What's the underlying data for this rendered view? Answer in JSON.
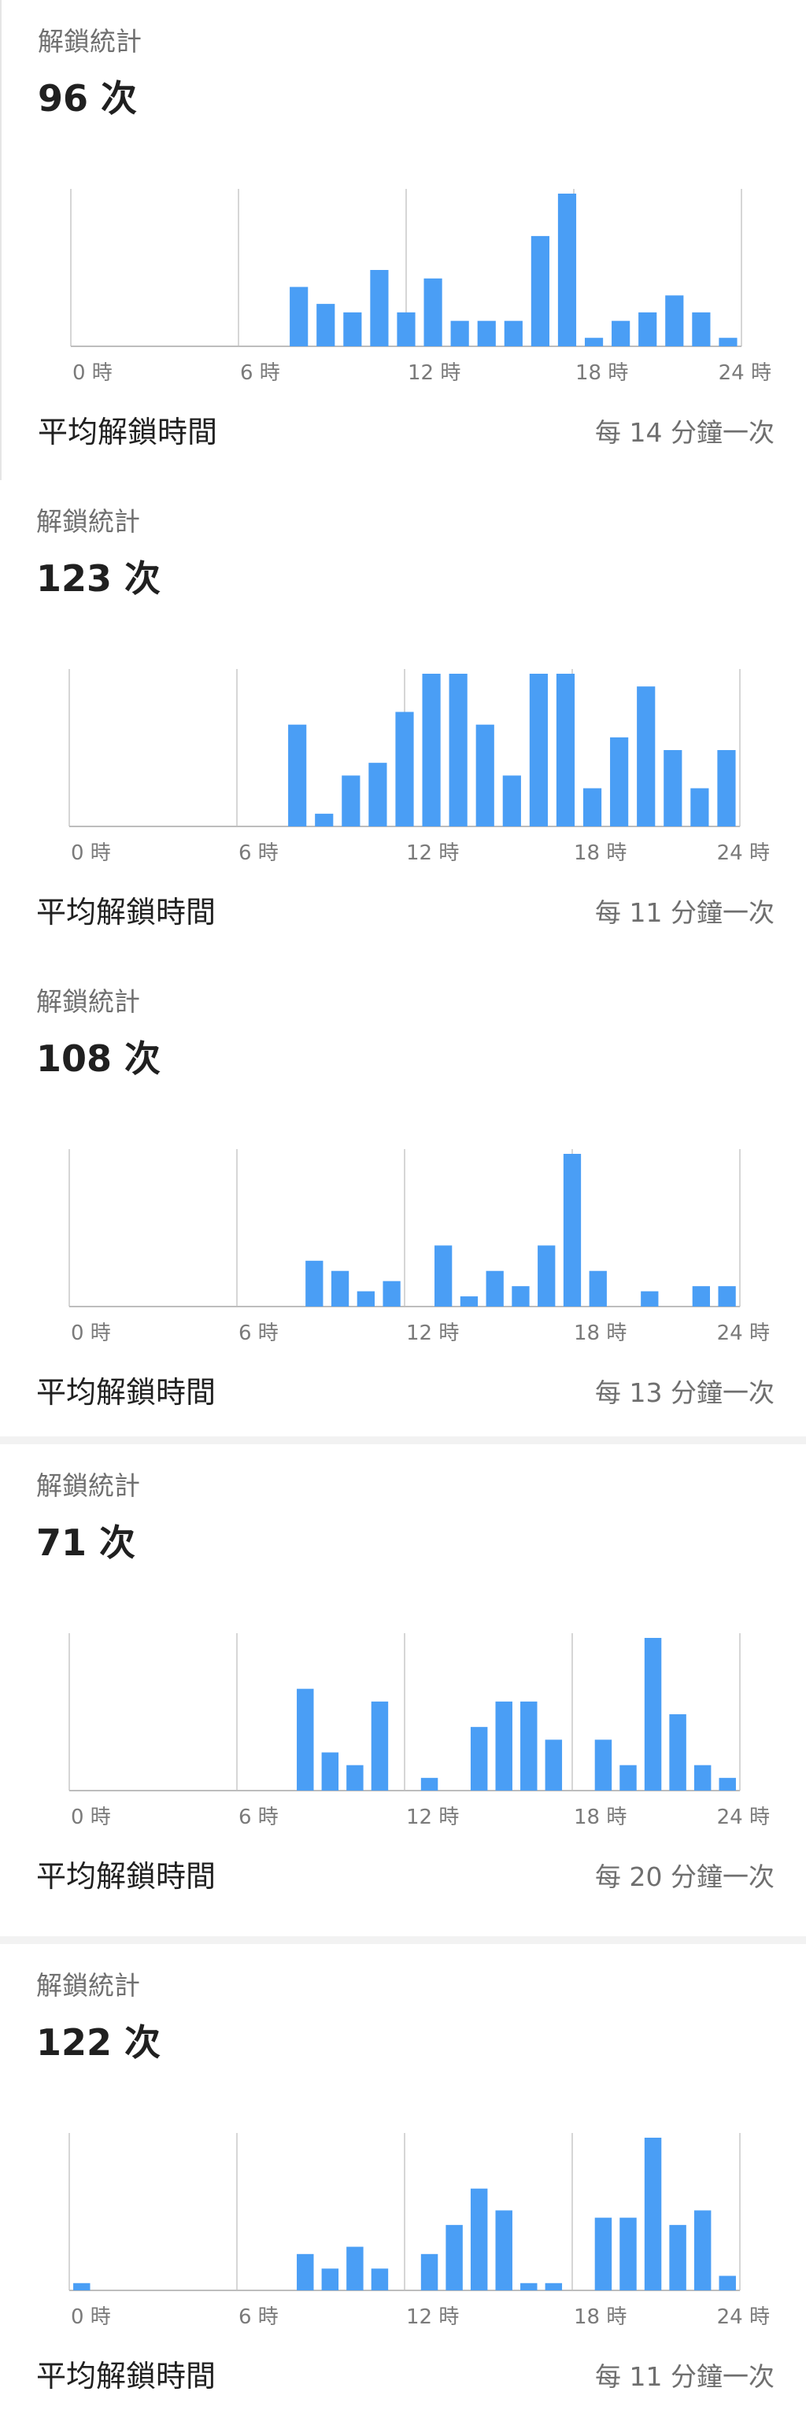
{
  "colors": {
    "bar": "#4a9ef5",
    "axis": "#bdbdbd",
    "grid": "#c8c8c8",
    "divider": "#f2f2f2"
  },
  "chart_data": [
    {
      "type": "bar",
      "title": "解鎖統計",
      "total_label": "96 次",
      "avg_label": "平均解鎖時間",
      "avg_value": "每 14 分鐘一次",
      "xticks": [
        "0 時",
        "6 時",
        "12 時",
        "18 時",
        "24 時"
      ],
      "x": [
        0,
        1,
        2,
        3,
        4,
        5,
        6,
        7,
        8,
        9,
        10,
        11,
        12,
        13,
        14,
        15,
        16,
        17,
        18,
        19,
        20,
        21,
        22,
        23
      ],
      "values": [
        0,
        0,
        0,
        0,
        0,
        0,
        0,
        0,
        7,
        5,
        4,
        9,
        4,
        8,
        3,
        3,
        3,
        13,
        18,
        1,
        3,
        4,
        6,
        4,
        1
      ],
      "ylim": [
        0,
        18
      ]
    },
    {
      "type": "bar",
      "title": "解鎖統計",
      "total_label": "123 次",
      "avg_label": "平均解鎖時間",
      "avg_value": "每 11 分鐘一次",
      "xticks": [
        "0 時",
        "6 時",
        "12 時",
        "18 時",
        "24 時"
      ],
      "x": [
        0,
        1,
        2,
        3,
        4,
        5,
        6,
        7,
        8,
        9,
        10,
        11,
        12,
        13,
        14,
        15,
        16,
        17,
        18,
        19,
        20,
        21,
        22,
        23
      ],
      "values": [
        0,
        0,
        0,
        0,
        0,
        0,
        0,
        0,
        8,
        1,
        4,
        5,
        9,
        12,
        12,
        8,
        4,
        12,
        12,
        3,
        7,
        11,
        6,
        3,
        6
      ],
      "ylim": [
        0,
        12
      ]
    },
    {
      "type": "bar",
      "title": "解鎖統計",
      "total_label": "108 次",
      "avg_label": "平均解鎖時間",
      "avg_value": "每 13 分鐘一次",
      "xticks": [
        "0 時",
        "6 時",
        "12 時",
        "18 時",
        "24 時"
      ],
      "x": [
        0,
        1,
        2,
        3,
        4,
        5,
        6,
        7,
        8,
        9,
        10,
        11,
        12,
        13,
        14,
        15,
        16,
        17,
        18,
        19,
        20,
        21,
        22,
        23
      ],
      "values": [
        0,
        0,
        0,
        0,
        0,
        0,
        0,
        0,
        0,
        9,
        7,
        3,
        5,
        0,
        12,
        2,
        7,
        4,
        12,
        30,
        7,
        0,
        3,
        0,
        4,
        4
      ],
      "ylim": [
        0,
        30
      ]
    },
    {
      "type": "bar",
      "title": "解鎖統計",
      "total_label": "71 次",
      "avg_label": "平均解鎖時間",
      "avg_value": "每 20 分鐘一次",
      "xticks": [
        "0 時",
        "6 時",
        "12 時",
        "18 時",
        "24 時"
      ],
      "x": [
        0,
        1,
        2,
        3,
        4,
        5,
        6,
        7,
        8,
        9,
        10,
        11,
        12,
        13,
        14,
        15,
        16,
        17,
        18,
        19,
        20,
        21,
        22,
        23
      ],
      "values": [
        0,
        0,
        0,
        0,
        0,
        0,
        0,
        0,
        0,
        8,
        3,
        2,
        7,
        0,
        1,
        0,
        5,
        7,
        7,
        4,
        0,
        4,
        2,
        12,
        6,
        2,
        1
      ],
      "ylim": [
        0,
        12
      ]
    },
    {
      "type": "bar",
      "title": "解鎖統計",
      "total_label": "122 次",
      "avg_label": "平均解鎖時間",
      "avg_value": "每 11 分鐘一次",
      "xticks": [
        "0 時",
        "6 時",
        "12 時",
        "18 時",
        "24 時"
      ],
      "x": [
        0,
        1,
        2,
        3,
        4,
        5,
        6,
        7,
        8,
        9,
        10,
        11,
        12,
        13,
        14,
        15,
        16,
        17,
        18,
        19,
        20,
        21,
        22,
        23
      ],
      "values": [
        1,
        0,
        0,
        0,
        0,
        0,
        0,
        0,
        0,
        5,
        3,
        6,
        3,
        0,
        5,
        9,
        14,
        11,
        1,
        1,
        0,
        10,
        10,
        21,
        9,
        11,
        2
      ],
      "ylim": [
        0,
        21
      ]
    }
  ]
}
